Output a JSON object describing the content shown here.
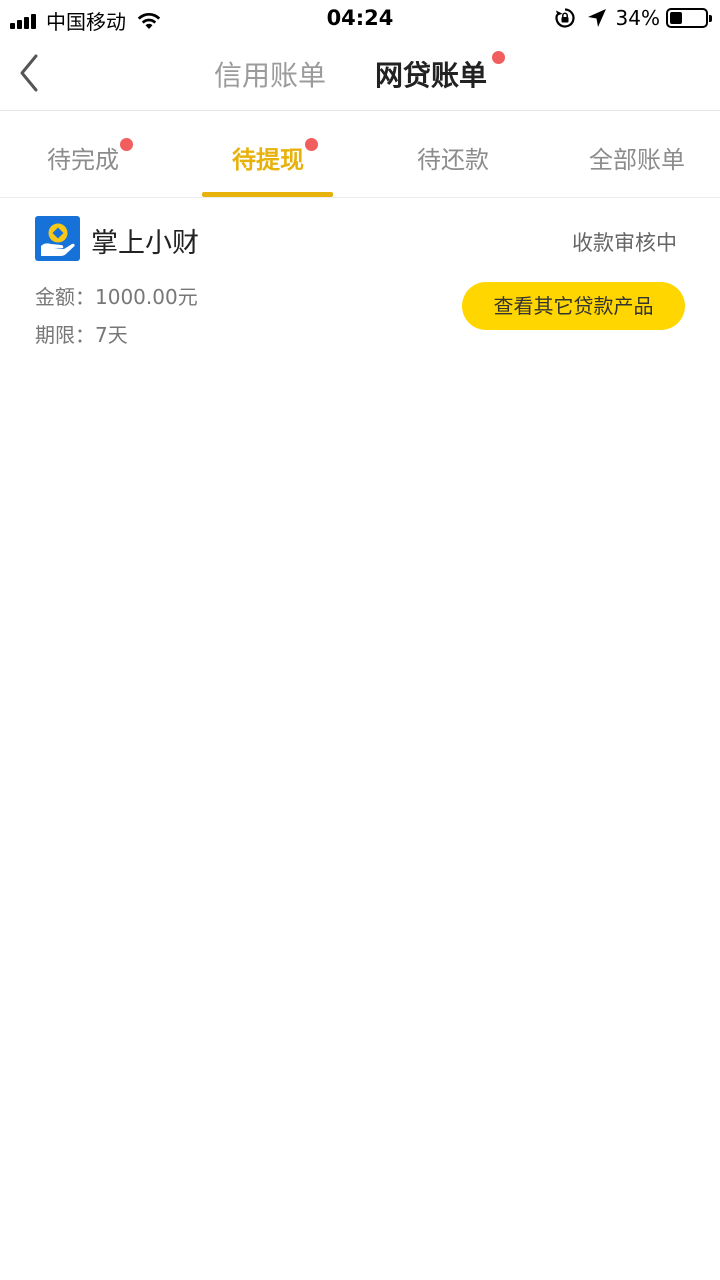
{
  "status_bar": {
    "carrier": "中国移动",
    "time": "04:24",
    "battery_percent": "34%",
    "battery_level": 0.34,
    "icons": [
      "signal-icon",
      "wifi-icon",
      "rotation-lock-icon",
      "location-arrow-icon",
      "battery-icon"
    ]
  },
  "header": {
    "back_icon": "chevron-left-icon",
    "tabs": [
      {
        "label": "信用账单",
        "active": false,
        "badge": false
      },
      {
        "label": "网贷账单",
        "active": true,
        "badge": true
      }
    ]
  },
  "sub_tabs": [
    {
      "label": "待完成",
      "active": false,
      "badge": true
    },
    {
      "label": "待提现",
      "active": true,
      "badge": true
    },
    {
      "label": "待还款",
      "active": false,
      "badge": false
    },
    {
      "label": "全部账单",
      "active": false,
      "badge": false
    }
  ],
  "loan": {
    "product_name": "掌上小财",
    "logo_icon": "coin-hand-logo-icon",
    "status": "收款审核中",
    "amount_label": "金额：",
    "amount_value": "1000.00元",
    "term_label": "期限：",
    "term_value": "7天",
    "action_label": "查看其它贷款产品"
  },
  "colors": {
    "accent": "#e7b20c",
    "button": "#ffd600",
    "badge": "#f25d5d",
    "logo_bg": "#1672d8"
  }
}
